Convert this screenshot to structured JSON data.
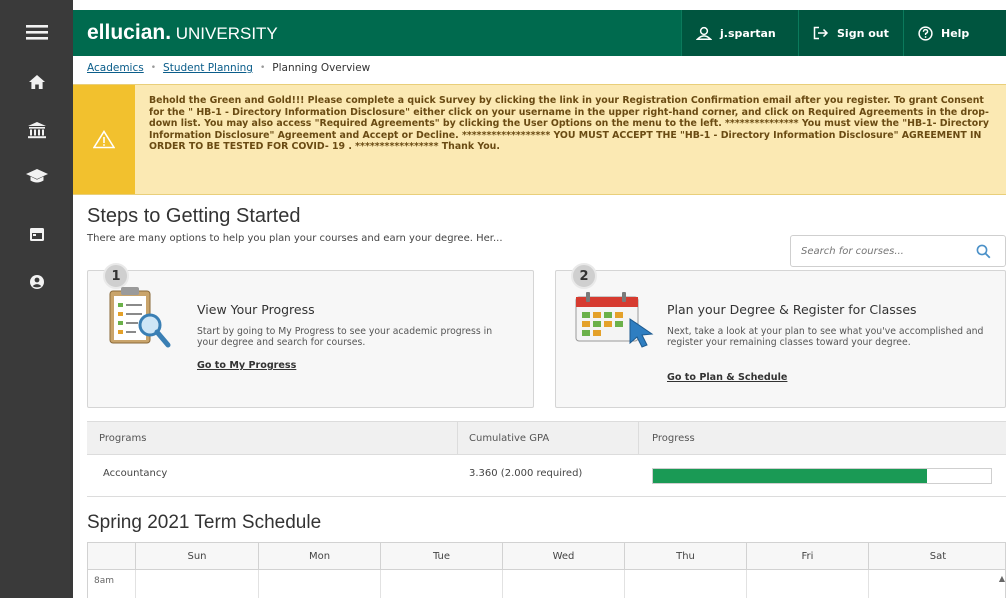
{
  "topbar": {
    "brand_main": "ellucian.",
    "brand_sub": " UNIVERSITY",
    "username": "j.spartan",
    "signout_label": "Sign out",
    "help_label": "Help"
  },
  "breadcrumb": {
    "items": [
      "Academics",
      "Student Planning",
      "Planning Overview"
    ]
  },
  "alert": {
    "message": "Behold the Green and Gold!!! Please complete a quick Survey by clicking the link in your Registration Confirmation email after you register. To grant Consent for the \" HB-1 - Directory Information Disclosure\" either click on your username in the upper right-hand corner, and click on Required Agreements in the drop-down list. You may also access \"Required Agreements\" by clicking the User Options on the menu to the left. *************** You must view the \"HB-1- Directory Information Disclosure\" Agreement and Accept or Decline. ****************** YOU MUST ACCEPT THE \"HB-1 - Directory Information Disclosure\" AGREEMENT IN ORDER TO BE TESTED FOR COVID- 19 . ***************** Thank You."
  },
  "steps": {
    "title": "Steps to Getting Started",
    "subtitle": "There are many options to help you plan your courses and earn your degree. Her...",
    "search_placeholder": "Search for courses..."
  },
  "cards": [
    {
      "number": "1",
      "title": "View Your Progress",
      "desc": "Start by going to My Progress to see your academic progress in your degree and search for courses.",
      "link": "Go to My Progress"
    },
    {
      "number": "2",
      "title": "Plan your Degree & Register for Classes",
      "desc": "Next, take a look at your plan to see what you've accomplished and register your remaining classes toward your degree.",
      "link": "Go to Plan & Schedule"
    }
  ],
  "programs": {
    "headers": [
      "Programs",
      "Cumulative GPA",
      "Progress"
    ],
    "rows": [
      {
        "program": "Accountancy",
        "gpa": "3.360 (2.000 required)",
        "progress": 0.81
      }
    ]
  },
  "term": {
    "title": "Spring 2021 Term Schedule",
    "days": [
      "Sun",
      "Mon",
      "Tue",
      "Wed",
      "Thu",
      "Fri",
      "Sat"
    ],
    "first_time": "8am"
  },
  "colors": {
    "brand_green": "#006a4e",
    "alert_yellow": "#f2c12e",
    "progress_green": "#1a9a55",
    "rail": "#3a3a3a"
  },
  "icons": [
    "menu-icon",
    "home-icon",
    "bank-icon",
    "graduation-cap-icon",
    "calendar-icon",
    "user-options-icon",
    "user-icon",
    "sign-out-icon",
    "help-icon",
    "warning-icon",
    "search-icon"
  ]
}
